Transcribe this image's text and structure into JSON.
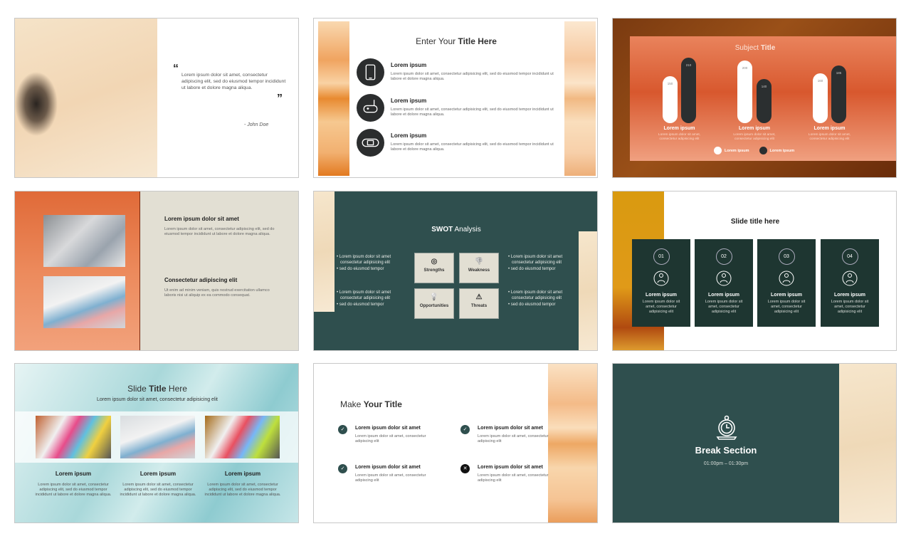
{
  "colors": {
    "dark_teal": "#2f4f4e",
    "card_green": "#1e3631",
    "orange": "#e88a30",
    "beige": "#e2dfd3",
    "chart_dark": "#2b2f30"
  },
  "slide_quote": {
    "open_quote": "“",
    "text": "Lorem ipsum dolor sit amet, consectetur adipiscing elit, sed do eiusmod tempor incididunt ut labore et dolore magna aliqua.",
    "close_quote": "”",
    "author": "- John Doe"
  },
  "slide_features": {
    "title_light": "Enter Your ",
    "title_bold": "Title Here",
    "items": [
      {
        "icon": "smartphone-icon",
        "heading": "Lorem ipsum",
        "body": "Lorem ipsum dolor sit amet, consectetur adipisicing elit, sed do eiusmod tempor incididunt ut labore et dolore magna aliqua."
      },
      {
        "icon": "gamepad-icon",
        "heading": "Lorem ipsum",
        "body": "Lorem ipsum dolor sit amet, consectetur adipisicing elit, sed do eiusmod tempor incididunt ut labore et dolore magna aliqua."
      },
      {
        "icon": "handheld-console-icon",
        "heading": "Lorem ipsum",
        "body": "Lorem ipsum dolor sit amet, consectetur adipisicing elit, sed do eiusmod tempor incididunt ut labore et dolore magna aliqua."
      }
    ]
  },
  "chart_data": {
    "type": "bar",
    "title_light": "Subject ",
    "title_bold": "Title",
    "categories": [
      "Lorem ipsum",
      "Lorem ipsum",
      "Lorem ipsum"
    ],
    "category_desc": "Lorem ipsum dolor sit amet, consectetur adipisicing elit",
    "series": [
      {
        "name": "Lorem ipsum",
        "color": "#ffffff",
        "values": [
          150,
          200,
          160
        ]
      },
      {
        "name": "Lorem ipsum",
        "color": "#2b2f30",
        "values": [
          210,
          140,
          185
        ]
      }
    ],
    "legend": "bottom"
  },
  "slide_photos": {
    "sections": [
      {
        "heading": "Lorem ipsum dolor sit amet",
        "body": "Lorem ipsum dolor sit amet, consectetur adipiscing elit, sed do eiusmod tempor incididunt ut labore et dolore magna aliqua."
      },
      {
        "heading": "Consectetur adipiscing elit",
        "body": "Ut enim ad minim veniam, quis nostrud exercitation ullamco laboris nisi ut aliquip ex ea commodo consequat."
      }
    ]
  },
  "slide_swot": {
    "title_bold": "SWOT",
    "title_light": " Analysis",
    "boxes": [
      {
        "icon": "target-icon",
        "label": "Strengths"
      },
      {
        "icon": "thumbs-down-icon",
        "label": "Weakness"
      },
      {
        "icon": "lightbulb-icon",
        "label": "Opportunities"
      },
      {
        "icon": "warning-icon",
        "label": "Threats"
      }
    ],
    "bullets": [
      [
        "Lorem ipsum dolor sit amet consectetur adipisicing elit",
        "sed do eiusmod tempor"
      ],
      [
        "Lorem ipsum dolor sit amet consectetur adipisicing elit",
        "sed do eiusmod tempor"
      ],
      [
        "Lorem ipsum dolor sit amet consectetur adipisicing elit",
        "sed do eiusmod tempor"
      ],
      [
        "Lorem ipsum dolor sit amet consectetur adipisicing elit",
        "sed do eiusmod tempor"
      ]
    ]
  },
  "slide_steps": {
    "title": "Slide title here",
    "cards": [
      {
        "num": "01",
        "icon": "network-people-icon",
        "heading": "Lorem ipsum",
        "body": "Lorem ipsum dolor sit amet, consectetur adipisicing elit"
      },
      {
        "num": "02",
        "icon": "team-idea-icon",
        "heading": "Lorem ipsum",
        "body": "Lorem ipsum dolor sit amet, consectetur adipisicing elit"
      },
      {
        "num": "03",
        "icon": "group-heart-icon",
        "heading": "Lorem ipsum",
        "body": "Lorem ipsum dolor sit amet, consectetur adipisicing elit"
      },
      {
        "num": "04",
        "icon": "globe-icon",
        "heading": "Lorem ipsum",
        "body": "Lorem ipsum dolor sit amet, consectetur adipisicing elit"
      }
    ]
  },
  "slide_gallery": {
    "title_light1": "Slide ",
    "title_bold": "Title",
    "title_light2": " Here",
    "subtitle": "Lorem ipsum dolor sit amet, consectetur adipisicing elit",
    "cols": [
      {
        "heading": "Lorem ipsum",
        "body": "Lorem ipsum dolor sit amet, consectetur adipiscing elit, sed do eiusmod tempor incididunt ut labore et dolore magna aliqua."
      },
      {
        "heading": "Lorem ipsum",
        "body": "Lorem ipsum dolor sit amet, consectetur adipiscing elit, sed do eiusmod tempor incididunt ut labore et dolore magna aliqua."
      },
      {
        "heading": "Lorem ipsum",
        "body": "Lorem ipsum dolor sit amet, consectetur adipiscing elit, sed do eiusmod tempor incididunt ut labore et dolore magna aliqua."
      }
    ]
  },
  "slide_checklist": {
    "title_light": "Make ",
    "title_bold": "Your Title",
    "items": [
      {
        "status": "check",
        "heading": "Lorem ipsum dolor sit amet",
        "body": "Lorem ipsum dolor sit amet, consectetur adipiscing elit"
      },
      {
        "status": "check",
        "heading": "Lorem ipsum dolor sit amet",
        "body": "Lorem ipsum dolor sit amet, consectetur adipiscing elit"
      },
      {
        "status": "check",
        "heading": "Lorem ipsum dolor sit amet",
        "body": "Lorem ipsum dolor sit amet, consectetur adipiscing elit"
      },
      {
        "status": "cross",
        "heading": "Lorem ipsum dolor sit amet",
        "body": "Lorem ipsum dolor sit amet, consectetur adipiscing elit"
      }
    ]
  },
  "slide_break": {
    "icon": "stopwatch-icon",
    "title": "Break Section",
    "time": "01:00pm – 01:30pm"
  }
}
